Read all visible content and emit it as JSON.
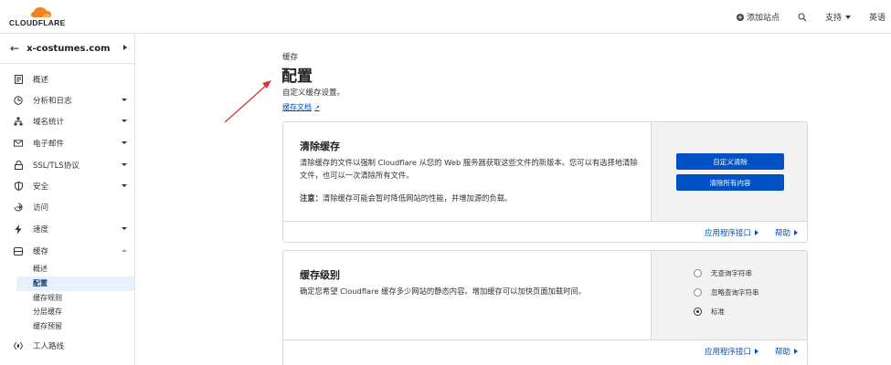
{
  "topbar": {
    "logo_text": "CLOUDFLARE",
    "add_site": "添加站点",
    "support": "支持",
    "language": "英语"
  },
  "sidebar": {
    "site_name": "x-costumes.com",
    "items": [
      {
        "label": "概述",
        "icon": "document-icon"
      },
      {
        "label": "分析和日志",
        "icon": "clock-chart-icon"
      },
      {
        "label": "域名统计",
        "icon": "sitemap-icon"
      },
      {
        "label": "电子邮件",
        "icon": "email-icon"
      },
      {
        "label": "SSL/TLS协议",
        "icon": "lock-icon"
      },
      {
        "label": "安全",
        "icon": "shield-icon"
      },
      {
        "label": "访问",
        "icon": "access-icon"
      },
      {
        "label": "速度",
        "icon": "bolt-icon"
      },
      {
        "label": "缓存",
        "icon": "storage-icon"
      },
      {
        "label": "工人路线",
        "icon": "workers-icon"
      }
    ],
    "cache_sub": [
      "概述",
      "配置",
      "缓存规则",
      "分层缓存",
      "缓存预留"
    ]
  },
  "main": {
    "eyebrow": "缓存",
    "title": "配置",
    "subtitle": "自定义缓存设置。",
    "doc_link": "缓存文档"
  },
  "purge_card": {
    "title": "清除缓存",
    "description": "清除缓存的文件以强制 Cloudflare 从您的 Web 服务器获取这些文件的新版本。您可以有选择地清除文件，也可以一次清除所有文件。",
    "note_label": "注意：",
    "note_text": "清除缓存可能会暂时降低网站的性能，并增加源的负载。",
    "btn_custom": "自定义清除",
    "btn_all": "清除所有内容",
    "api_link": "应用程序接口",
    "help_link": "帮助"
  },
  "level_card": {
    "title": "缓存级别",
    "description": "确定您希望 Cloudflare 缓存多少网站的静态内容。增加缓存可以加快页面加载时间。",
    "options": [
      "无查询字符串",
      "忽略查询字符串",
      "标准"
    ],
    "selected": "标准",
    "api_link": "应用程序接口",
    "help_link": "帮助"
  },
  "colors": {
    "accent": "#0051c3",
    "logo_orange": "#f48120",
    "annotation": "#d9342b"
  }
}
